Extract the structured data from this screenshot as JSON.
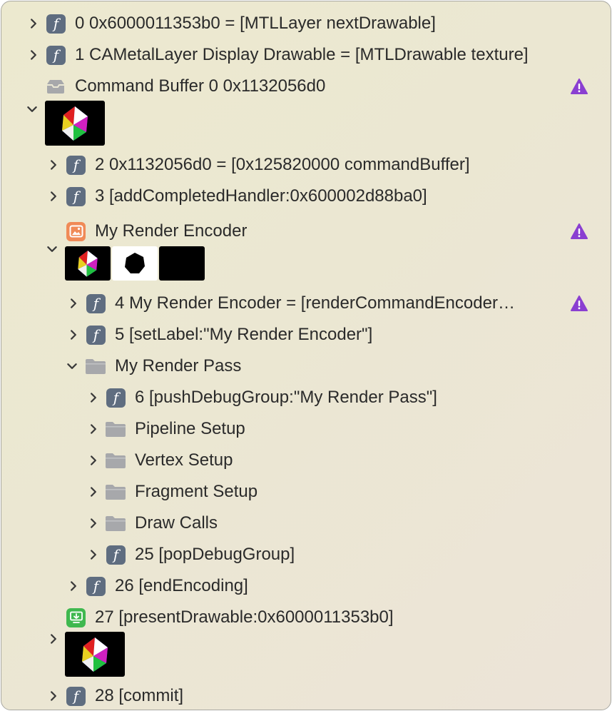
{
  "colors": {
    "function_icon": "#5f6d80",
    "folder_icon": "#a7a8ab",
    "encoder_icon": "#f08a57",
    "present_icon": "#3fb84f",
    "warning": "#8a3fd1",
    "text": "#2a2a2a"
  },
  "rows": [
    {
      "label": "0 0x6000011353b0 = [MTLLayer nextDrawable]",
      "icon": "function-icon",
      "expanded": false
    },
    {
      "label": "1 CAMetalLayer Display Drawable = [MTLDrawable texture]",
      "icon": "function-icon",
      "expanded": false
    },
    {
      "label": "Command Buffer 0 0x1132056d0",
      "icon": "command-buffer-icon",
      "warning": true
    },
    {
      "label": "",
      "icon": "",
      "expanded": true,
      "thumbnails": [
        "render-thumbnail"
      ]
    },
    {
      "label": "2 0x1132056d0 = [0x125820000 commandBuffer]",
      "icon": "function-icon",
      "expanded": false
    },
    {
      "label": "3 [addCompletedHandler:0x600002d88ba0]",
      "icon": "function-icon",
      "expanded": false
    },
    {
      "label": "My Render Encoder",
      "icon": "render-encoder-icon",
      "warning": true
    },
    {
      "label": "",
      "icon": "",
      "expanded": true,
      "thumbnails": [
        "render-thumbnail",
        "depth-thumbnail",
        "black-thumbnail"
      ]
    },
    {
      "label": "4 My Render Encoder = [renderCommandEncoder…",
      "icon": "function-icon",
      "expanded": false,
      "warning": true
    },
    {
      "label": "5 [setLabel:\"My Render Encoder\"]",
      "icon": "function-icon",
      "expanded": false
    },
    {
      "label": "My Render Pass",
      "icon": "folder-icon",
      "expanded": true
    },
    {
      "label": "6 [pushDebugGroup:\"My Render Pass\"]",
      "icon": "function-icon",
      "expanded": false
    },
    {
      "label": "Pipeline Setup",
      "icon": "folder-icon",
      "expanded": false
    },
    {
      "label": "Vertex Setup",
      "icon": "folder-icon",
      "expanded": false
    },
    {
      "label": "Fragment Setup",
      "icon": "folder-icon",
      "expanded": false
    },
    {
      "label": "Draw Calls",
      "icon": "folder-icon",
      "expanded": false
    },
    {
      "label": "25 [popDebugGroup]",
      "icon": "function-icon",
      "expanded": false
    },
    {
      "label": "26 [endEncoding]",
      "icon": "function-icon",
      "expanded": false
    },
    {
      "label": "27 [presentDrawable:0x6000011353b0]",
      "icon": "present-drawable-icon"
    },
    {
      "label": "",
      "icon": "",
      "expanded": false,
      "thumbnails": [
        "render-thumbnail"
      ]
    },
    {
      "label": "28 [commit]",
      "icon": "function-icon",
      "expanded": false
    }
  ]
}
